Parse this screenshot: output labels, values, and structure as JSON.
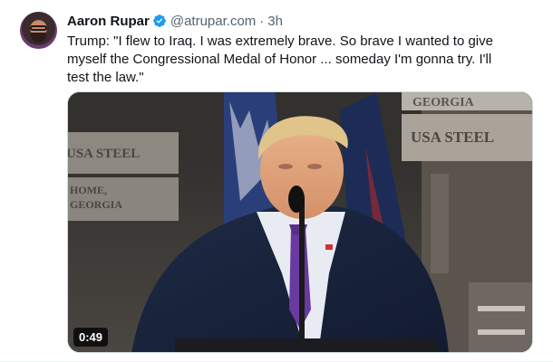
{
  "post": {
    "author_name": "Aaron Rupar",
    "handle": "@atrupar.com",
    "separator": "·",
    "time": "3h",
    "text": "Trump: \"I flew to Iraq. I was extremely brave. So brave I wanted to give\nmyself the Congressional Medal of Honor ... someday I'm gonna try. I'll\ntest the law.\""
  },
  "media": {
    "duration": "0:49",
    "signs": {
      "georgia_top": "GEORGIA",
      "usa_steel_right": "USA STEEL",
      "usa_steel_left": "USA STEEL",
      "home_georgia": "HOME,\nGEORGIA"
    }
  },
  "colors": {
    "verified_blue": "#1d9bf0",
    "text": "#0f1419",
    "secondary": "#536471"
  },
  "icons": {
    "verified": "verified-badge-icon",
    "avatar": "avatar"
  }
}
